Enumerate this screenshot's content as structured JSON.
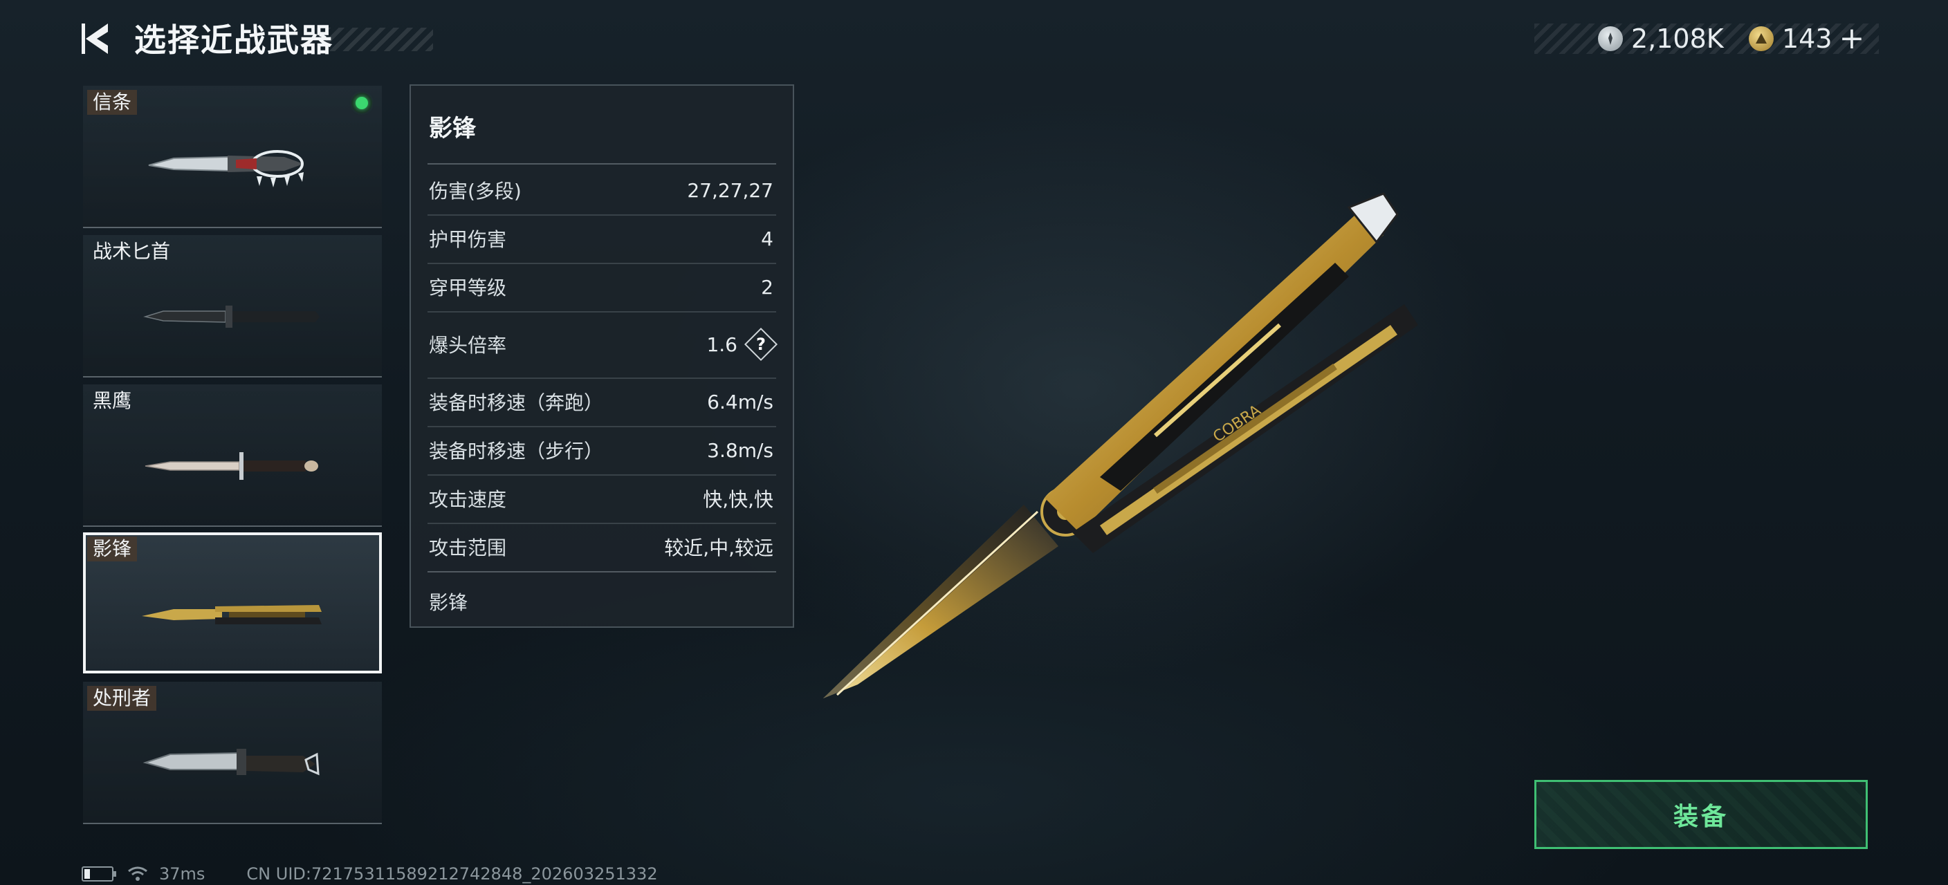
{
  "header": {
    "title": "选择近战武器",
    "currency_1": "2,108K",
    "currency_2": "143",
    "currency_2_add": "+"
  },
  "weapons": [
    {
      "label": "信条",
      "equipped": true
    },
    {
      "label": "战术匕首",
      "equipped": false
    },
    {
      "label": "黑鹰",
      "equipped": false
    },
    {
      "label": "影锋",
      "equipped": false,
      "selected": true
    },
    {
      "label": "处刑者",
      "equipped": false
    }
  ],
  "stats": {
    "title": "影锋",
    "rows": [
      {
        "name": "伤害(多段)",
        "value": "27,27,27"
      },
      {
        "name": "护甲伤害",
        "value": "4"
      },
      {
        "name": "穿甲等级",
        "value": "2"
      },
      {
        "name": "爆头倍率",
        "value": "1.6",
        "help": "?"
      },
      {
        "name": "装备时移速（奔跑）",
        "value": "6.4m/s"
      },
      {
        "name": "装备时移速（步行）",
        "value": "3.8m/s"
      },
      {
        "name": "攻击速度",
        "value": "快,快,快"
      },
      {
        "name": "攻击范围",
        "value": "较近,中,较远"
      }
    ],
    "footer": "影锋"
  },
  "equip_button": "装备",
  "statusbar": {
    "ping": "37ms",
    "uid": "CN UID:7217531158921274284​8_202603251332"
  },
  "colors": {
    "accent_green": "#3fbf73",
    "equipped_dot": "#3bd76f",
    "gold": "#c9a84a"
  }
}
